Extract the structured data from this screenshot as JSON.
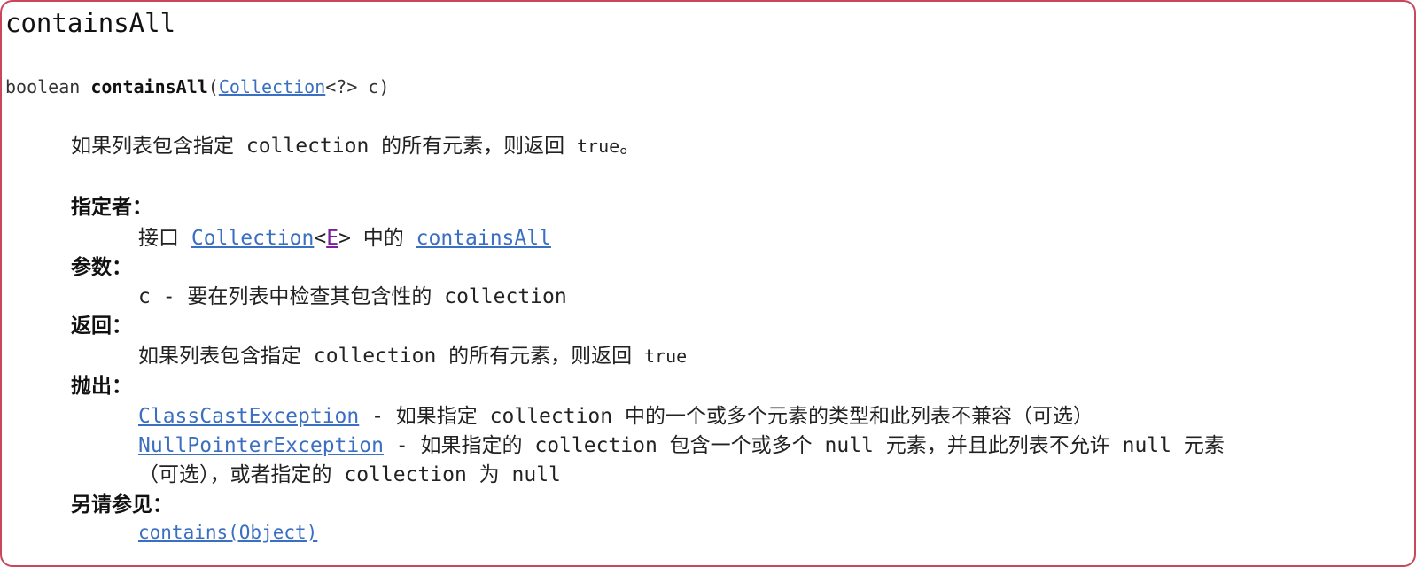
{
  "method": {
    "title": "containsAll",
    "signature": {
      "return_type": "boolean",
      "name": "containsAll",
      "open_paren": "(",
      "param_type_link": "Collection",
      "param_rest": "<?> c)"
    },
    "description": {
      "text": "如果列表包含指定 collection 的所有元素，则返回 ",
      "code": "true",
      "end": "。"
    }
  },
  "specified_by": {
    "label": "指定者：",
    "prefix": "接口 ",
    "interface_link": "Collection",
    "lt": "<",
    "type_param_link": "E",
    "gt": ">",
    "middle": " 中的 ",
    "method_link": "containsAll"
  },
  "parameters": {
    "label": "参数：",
    "text": "c - 要在列表中检查其包含性的 collection"
  },
  "returns": {
    "label": "返回：",
    "text": "如果列表包含指定 collection 的所有元素，则返回 ",
    "code": "true"
  },
  "throws": {
    "label": "抛出：",
    "items": [
      {
        "exception_link": "ClassCastException",
        "text": " - 如果指定 collection 中的一个或多个元素的类型和此列表不兼容（可选）"
      },
      {
        "exception_link": "NullPointerException",
        "text": " - 如果指定的 collection 包含一个或多个 null 元素，并且此列表不允许 null 元素",
        "continuation": "（可选），或者指定的 collection 为 null"
      }
    ]
  },
  "see_also": {
    "label": "另请参见：",
    "link": "contains(Object)"
  },
  "colors": {
    "link": "#3b6fc2",
    "visited_link": "#7b1fa2",
    "frame_border": "#c9475e"
  }
}
